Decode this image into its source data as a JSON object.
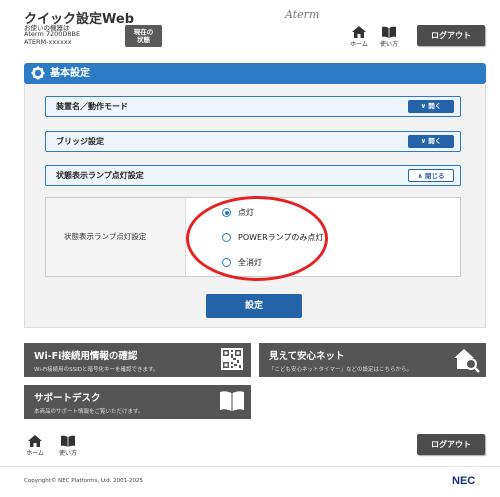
{
  "header": {
    "app_title": "クイック設定Web",
    "device_lines": [
      "お使いの機器は",
      "Aterm 7200D8BE",
      "ATERM-xxxxxx"
    ],
    "status_button": [
      "現在の",
      "状態"
    ],
    "brand": "Aterm",
    "home_label": "ホーム",
    "howto_label": "使い方",
    "logout_label": "ログアウト"
  },
  "main": {
    "title": "基本設定",
    "sections": [
      {
        "label": "装置名／動作モード",
        "toggle": "∨ 開く",
        "state": "collapsed"
      },
      {
        "label": "ブリッジ設定",
        "toggle": "∨ 開く",
        "state": "collapsed"
      },
      {
        "label": "状態表示ランプ点灯設定",
        "toggle": "∧ 閉じる",
        "state": "expanded"
      }
    ],
    "lamp_setting": {
      "label": "状態表示ランプ点灯設定",
      "options": [
        "点灯",
        "POWERランプのみ点灯",
        "全消灯"
      ],
      "selected": "点灯"
    },
    "apply_label": "設定"
  },
  "tiles": {
    "wifi": {
      "title": "Wi-Fi接続用情報の確認",
      "desc": "Wi-Fi接続用のSSIDと暗号化キーを確認できます。",
      "icon": "qr-code-icon"
    },
    "safety": {
      "title": "見えて安心ネット",
      "desc": "「こども安心ネットタイマー」などの設定はこちらから。",
      "icon": "home-search-icon"
    },
    "support": {
      "title": "サポートデスク",
      "desc": "本商品のサポート情報をご覧いただけます。",
      "icon": "book-icon"
    }
  },
  "footer": {
    "home_label": "ホーム",
    "howto_label": "使い方",
    "logout_label": "ログアウト",
    "copyright": "Copyright© NEC Platforms, Ltd. 2001-2025",
    "brand": "NEC"
  },
  "colors": {
    "accent": "#2d7bc4",
    "dark_button": "#4d4d4d",
    "highlight": "#e52222"
  }
}
